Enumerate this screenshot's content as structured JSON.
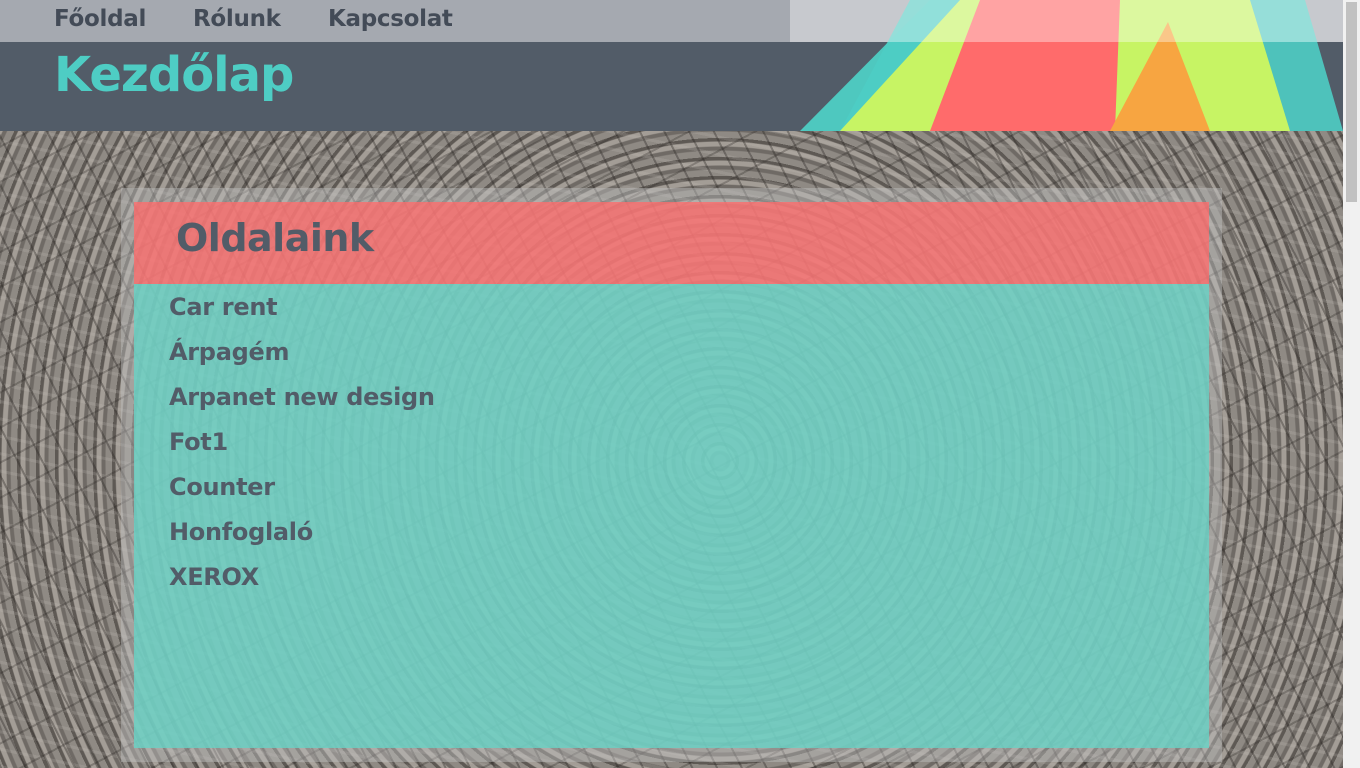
{
  "nav": {
    "items": [
      {
        "label": "Főoldal"
      },
      {
        "label": "Rólunk"
      },
      {
        "label": "Kapcsolat"
      }
    ]
  },
  "header": {
    "title": "Kezdőlap"
  },
  "panel": {
    "title": "Oldalaink",
    "links": [
      {
        "label": "Car rent"
      },
      {
        "label": "Árpagém"
      },
      {
        "label": "Arpanet new design"
      },
      {
        "label": "Fot1"
      },
      {
        "label": "Counter"
      },
      {
        "label": "Honfoglaló"
      },
      {
        "label": "XEROX"
      }
    ]
  },
  "colors": {
    "accent_teal": "#4ecdc4",
    "accent_red": "#ff6b6b",
    "accent_green": "#c7f464",
    "accent_orange": "#f7a541",
    "header_dark": "#525c68",
    "nav_gray": "#a5a9b0"
  }
}
